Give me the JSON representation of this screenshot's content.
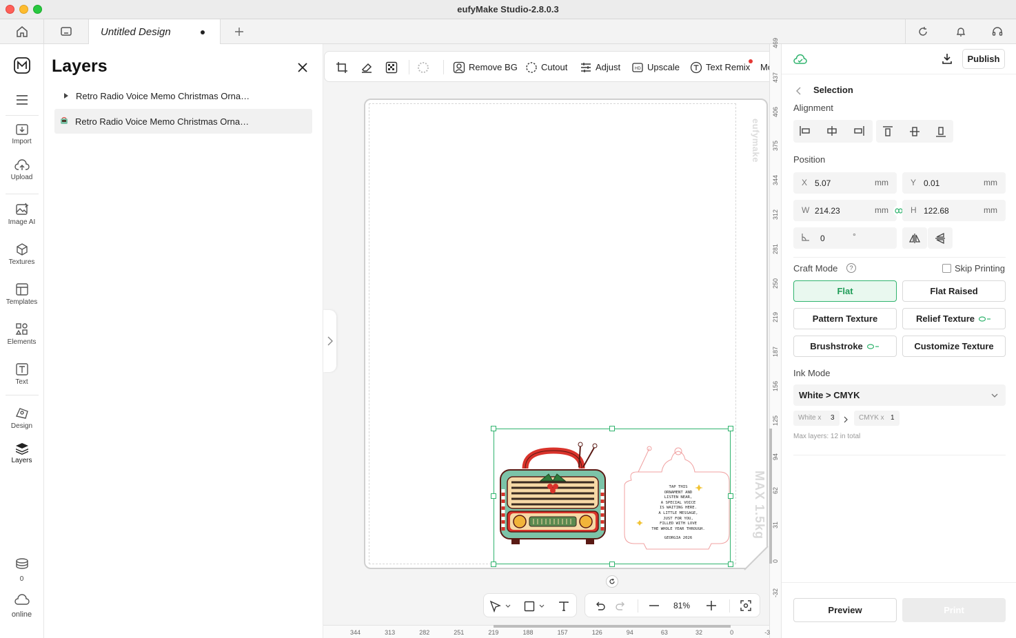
{
  "window": {
    "title": "eufyMake Studio-2.8.0.3"
  },
  "tabs": {
    "document_title": "Untitled Design"
  },
  "sidebar": {
    "items": [
      {
        "label": "Import"
      },
      {
        "label": "Upload"
      },
      {
        "label": "Image AI"
      },
      {
        "label": "Textures"
      },
      {
        "label": "Templates"
      },
      {
        "label": "Elements"
      },
      {
        "label": "Text"
      },
      {
        "label": "Design"
      },
      {
        "label": "Layers"
      }
    ],
    "credits": "0",
    "status": "online"
  },
  "layers_panel": {
    "title": "Layers",
    "items": [
      {
        "label": "Retro Radio Voice Memo Christmas Orna…"
      },
      {
        "label": "Retro Radio Voice Memo Christmas Orna…"
      }
    ]
  },
  "toolbar": {
    "remove_bg": "Remove BG",
    "cutout": "Cutout",
    "adjust": "Adjust",
    "upscale": "Upscale",
    "text_remix": "Text Remix",
    "more": "More"
  },
  "canvas": {
    "watermark": "eufymake",
    "max_weight": "MAX 1.5kg",
    "zoom": "81%",
    "ornament_text": [
      "TAP THIS",
      "ORNAMENT AND",
      "LISTEN NEAR,",
      "A SPECIAL VOICE",
      "IS WAITING HERE.",
      "A LITTLE MESSAGE,",
      "JUST FOR YOU,",
      "FILLED WITH LOVE",
      "THE WHOLE YEAR THROUGH.",
      "",
      "GEORGIA 2026"
    ]
  },
  "rulers": {
    "vertical": [
      "469",
      "437",
      "406",
      "375",
      "344",
      "312",
      "281",
      "250",
      "219",
      "187",
      "156",
      "125",
      "94",
      "62",
      "31",
      "0",
      "-32"
    ],
    "horizontal": [
      "344",
      "313",
      "282",
      "251",
      "219",
      "188",
      "157",
      "126",
      "94",
      "63",
      "32",
      "0",
      "-3"
    ]
  },
  "right_panel": {
    "publish": "Publish",
    "selection": "Selection",
    "alignment": "Alignment",
    "position": "Position",
    "x": {
      "label": "X",
      "value": "5.07",
      "unit": "mm"
    },
    "y": {
      "label": "Y",
      "value": "0.01",
      "unit": "mm"
    },
    "w": {
      "label": "W",
      "value": "214.23",
      "unit": "mm"
    },
    "h": {
      "label": "H",
      "value": "122.68",
      "unit": "mm"
    },
    "rotation": {
      "value": "0",
      "unit": "°"
    },
    "craft_mode": "Craft Mode",
    "skip_printing": "Skip Printing",
    "modes": [
      "Flat",
      "Flat Raised",
      "Pattern Texture",
      "Relief Texture",
      "Brushstroke",
      "Customize Texture"
    ],
    "ink_mode": "Ink Mode",
    "ink_select": "White > CMYK",
    "white_count": {
      "label": "White x",
      "value": "3"
    },
    "cmyk_count": {
      "label": "CMYK x",
      "value": "1"
    },
    "max_layers": "Max layers: 12 in total",
    "preview": "Preview",
    "print": "Print"
  },
  "colors": {
    "accent": "#2fb36d",
    "radio_teal": "#7cc3a8",
    "radio_red": "#d9332b"
  }
}
